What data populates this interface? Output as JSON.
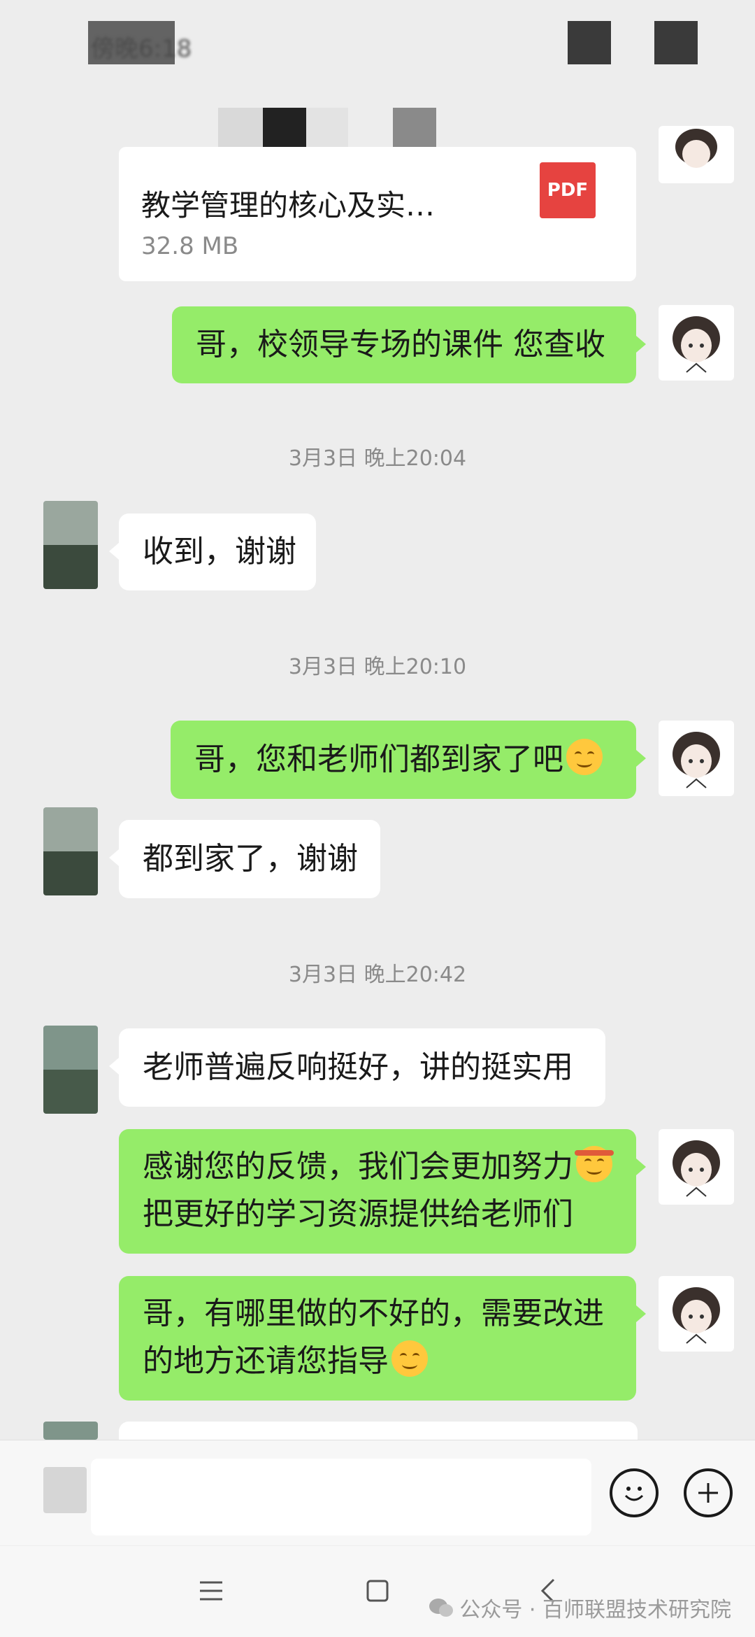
{
  "status_bar": {
    "time": "傍晚6:18"
  },
  "file_message": {
    "name": "教学管理的核心及实…",
    "size": "32.8 MB",
    "type_badge": "PDF"
  },
  "messages": [
    {
      "side": "me",
      "text": "哥，校领导专场的课件 您查收"
    },
    {
      "timestamp": "3月3日 晚上20:04"
    },
    {
      "side": "them",
      "text": "收到，谢谢"
    },
    {
      "timestamp": "3月3日 晚上20:10"
    },
    {
      "side": "me",
      "text": "哥，您和老师们都到家了吧",
      "emoji": "smile"
    },
    {
      "side": "them",
      "text": "都到家了，谢谢"
    },
    {
      "timestamp": "3月3日 晚上20:42"
    },
    {
      "side": "them",
      "text": "老师普遍反响挺好，讲的挺实用"
    },
    {
      "side": "me",
      "lines": [
        "感谢您的反馈，我们会更加努力",
        "把更好的学习资源提供给老师们"
      ],
      "emoji": "determined"
    },
    {
      "side": "me",
      "lines": [
        "哥，有哪里做的不好的，需要改进",
        "的地方还请您指导"
      ],
      "emoji": "smile"
    }
  ],
  "text": {
    "m1": "哥，校领导专场的课件 您查收",
    "t1": "3月3日 晚上20:04",
    "m2": "收到，谢谢",
    "t2": "3月3日 晚上20:10",
    "m3": "哥，您和老师们都到家了吧",
    "m4": "都到家了，谢谢",
    "t3": "3月3日 晚上20:42",
    "m5": "老师普遍反响挺好，讲的挺实用",
    "m6a": "感谢您的反馈，我们会更加努力",
    "m6b": "把更好的学习资源提供给老师们",
    "m7a": "哥，有哪里做的不好的，需要改进",
    "m7b": "的地方还请您指导"
  },
  "input_bar": {
    "value": ""
  },
  "watermark": "公众号 · 百师联盟技术研究院",
  "colors": {
    "my_bubble": "#95ec69",
    "their_bubble": "#ffffff",
    "background": "#ededed",
    "pdf_badge": "#e64340"
  }
}
